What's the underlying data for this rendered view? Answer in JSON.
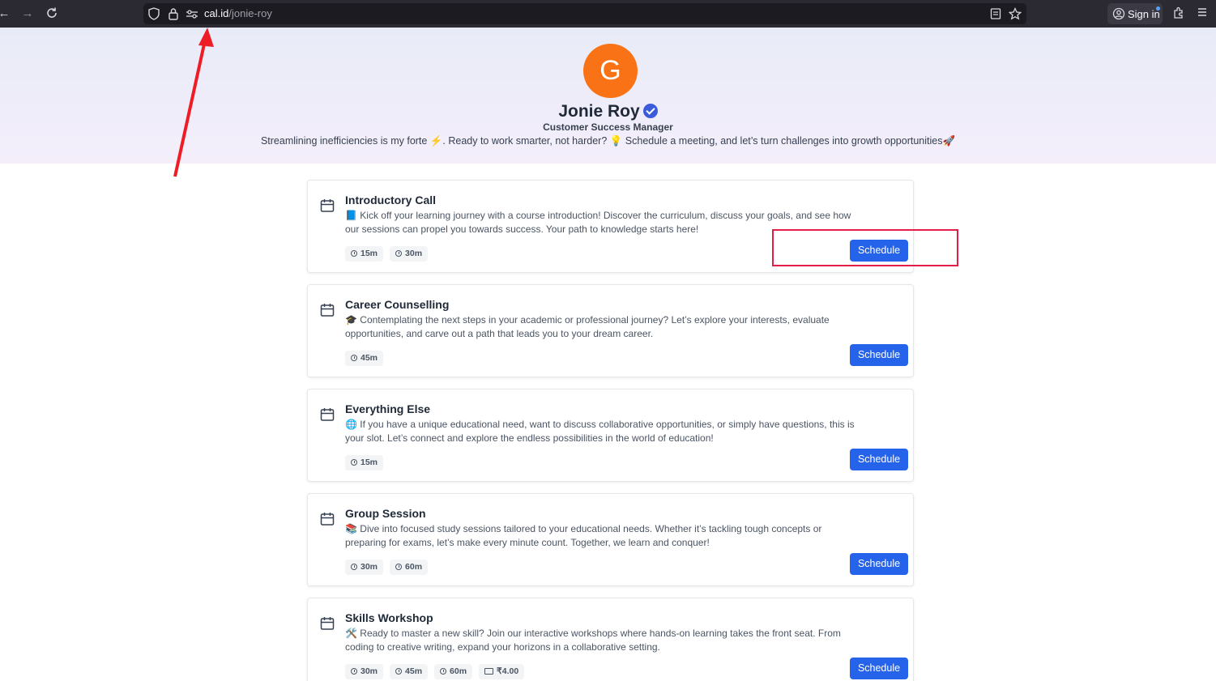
{
  "browser": {
    "url_host": "cal.id",
    "url_path": "/jonie-roy",
    "signin_label": "Sign in"
  },
  "profile": {
    "avatar_letter": "G",
    "name": "Jonie Roy",
    "role": "Customer Success Manager",
    "bio": "Streamlining inefficiencies is my forte ⚡. Ready to work smarter, not harder? 💡 Schedule a meeting, and let’s turn challenges into growth opportunities🚀"
  },
  "events": [
    {
      "title": "Introductory Call",
      "description": "📘 Kick off your learning journey with a course introduction! Discover the curriculum, discuss your goals, and see how our sessions can propel you towards success. Your path to knowledge starts here!",
      "durations": [
        "15m",
        "30m"
      ],
      "price": null,
      "button": "Schedule"
    },
    {
      "title": "Career Counselling",
      "description": "🎓 Contemplating the next steps in your academic or professional journey? Let’s explore your interests, evaluate opportunities, and carve out a path that leads you to your dream career.",
      "durations": [
        "45m"
      ],
      "price": null,
      "button": "Schedule"
    },
    {
      "title": "Everything Else",
      "description": "🌐 If you have a unique educational need, want to discuss collaborative opportunities, or simply have questions, this is your slot. Let’s connect and explore the endless possibilities in the world of education!",
      "durations": [
        "15m"
      ],
      "price": null,
      "button": "Schedule"
    },
    {
      "title": "Group Session",
      "description": "📚 Dive into focused study sessions tailored to your educational needs. Whether it’s tackling tough concepts or preparing for exams, let’s make every minute count. Together, we learn and conquer!",
      "durations": [
        "30m",
        "60m"
      ],
      "price": null,
      "button": "Schedule"
    },
    {
      "title": "Skills Workshop",
      "description": "🛠️ Ready to master a new skill? Join our interactive workshops where hands-on learning takes the front seat. From coding to creative writing, expand your horizons in a collaborative setting.",
      "durations": [
        "30m",
        "45m",
        "60m"
      ],
      "price": "₹4.00",
      "button": "Schedule"
    }
  ],
  "colors": {
    "primary": "#2563eb",
    "avatar": "#f97316",
    "annotation": "#e11d48"
  }
}
